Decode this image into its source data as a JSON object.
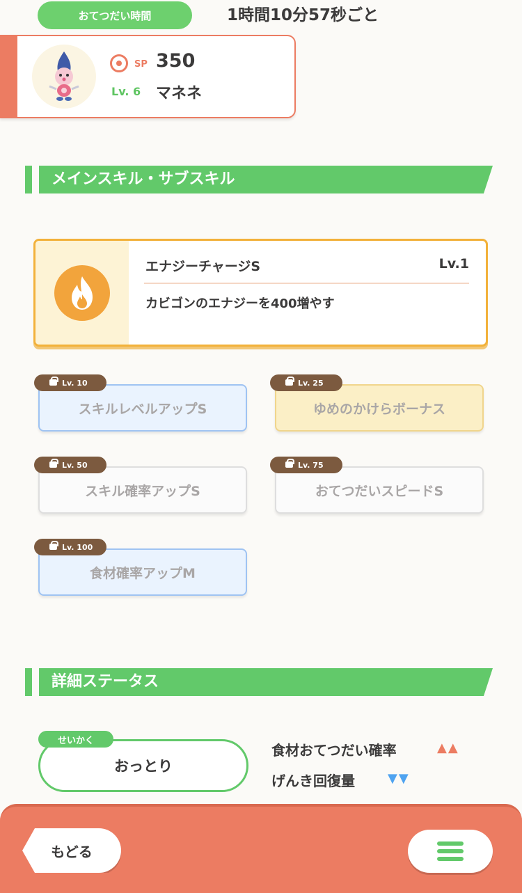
{
  "help": {
    "label": "おてつだい時間",
    "time": "1時間10分57秒ごと"
  },
  "pokemon": {
    "sp_label": "SP",
    "sp_value": "350",
    "level": "Lv. 6",
    "name": "マネネ",
    "avatar_icon": "mime-jr-sprite"
  },
  "sections": {
    "skills_title": "メインスキル・サブスキル",
    "status_title": "詳細ステータス"
  },
  "main_skill": {
    "name": "エナジーチャージS",
    "level": "Lv.1",
    "description": "カビゴンのエナジーを400増やす",
    "icon": "fire-icon"
  },
  "sub_skills": [
    {
      "unlock": "Lv. 10",
      "name": "スキルレベルアップS",
      "rarity": "blue"
    },
    {
      "unlock": "Lv. 25",
      "name": "ゆめのかけらボーナス",
      "rarity": "gold"
    },
    {
      "unlock": "Lv. 50",
      "name": "スキル確率アップS",
      "rarity": "white"
    },
    {
      "unlock": "Lv. 75",
      "name": "おてつだいスピードS",
      "rarity": "white"
    },
    {
      "unlock": "Lv. 100",
      "name": "食材確率アップM",
      "rarity": "blue"
    }
  ],
  "nature": {
    "tag": "せいかく",
    "value": "おっとり",
    "effects": [
      {
        "label": "食材おてつだい確率",
        "arrows": "▲▲",
        "color": "#ec7c62"
      },
      {
        "label": "げんき回復量",
        "arrows": "▼▼",
        "color": "#4fa3f0"
      }
    ]
  },
  "bottom": {
    "back_label": "もどる",
    "menu_icon": "hamburger-menu-icon"
  },
  "colors": {
    "accent_green": "#62c96a",
    "accent_orange": "#ec7c62",
    "skill_gold": "#f2b13a"
  }
}
